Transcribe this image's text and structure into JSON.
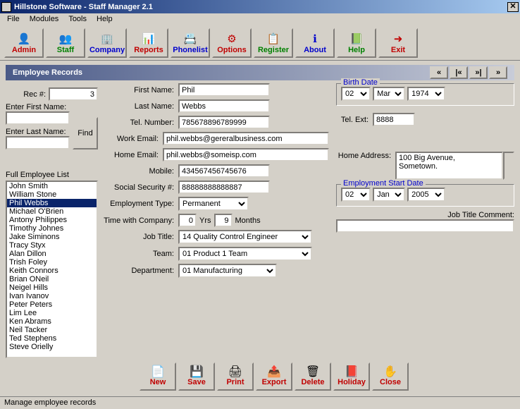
{
  "window": {
    "title": "Hillstone Software - Staff Manager 2.1"
  },
  "menu": [
    "File",
    "Modules",
    "Tools",
    "Help"
  ],
  "toolbar": [
    {
      "label": "Admin",
      "icon": "👤",
      "cls": "red"
    },
    {
      "label": "Staff",
      "icon": "👥",
      "cls": "green"
    },
    {
      "label": "Company",
      "icon": "🏢",
      "cls": "blue"
    },
    {
      "label": "Reports",
      "icon": "📊",
      "cls": "red"
    },
    {
      "label": "Phonelist",
      "icon": "📇",
      "cls": "blue"
    },
    {
      "label": "Options",
      "icon": "⚙",
      "cls": "red"
    },
    {
      "label": "Register",
      "icon": "📋",
      "cls": "green"
    },
    {
      "label": "About",
      "icon": "ℹ",
      "cls": "blue"
    },
    {
      "label": "Help",
      "icon": "📗",
      "cls": "green"
    },
    {
      "label": "Exit",
      "icon": "➜",
      "cls": "red"
    }
  ],
  "header": {
    "title": "Employee Records"
  },
  "nav": [
    "«",
    "|«",
    "»|",
    "»"
  ],
  "left": {
    "rec_label": "Rec #:",
    "rec_value": "3",
    "first_label": "Enter First Name:",
    "first_value": "",
    "last_label": "Enter Last Name:",
    "last_value": "",
    "find": "Find",
    "list_label": "Full Employee List",
    "list": [
      "John Smith",
      "William Stone",
      "Phil Webbs",
      "Michael O'Brien",
      "Antony Philippes",
      "Timothy Johnes",
      "Jake Siminons",
      "Tracy Styx",
      "Alan Dillon",
      "Trish Foley",
      "Keith Connors",
      "Brian ONeil",
      "Neigel Hills",
      "Ivan Ivanov",
      "Peter Peters",
      "Lim Lee",
      "Ken Abrams",
      "Neil Tacker",
      "Ted Stephens",
      "Steve Orielly"
    ],
    "selected_index": 2
  },
  "form": {
    "first_name": {
      "label": "First Name:",
      "value": "Phil"
    },
    "last_name": {
      "label": "Last Name:",
      "value": "Webbs"
    },
    "tel": {
      "label": "Tel. Number:",
      "value": "785678896789999"
    },
    "work_email": {
      "label": "Work Email:",
      "value": "phil.webbs@gereralbusiness.com"
    },
    "home_email": {
      "label": "Home Email:",
      "value": "phil.webbs@someisp.com"
    },
    "mobile": {
      "label": "Mobile:",
      "value": "434567456745676"
    },
    "ssn": {
      "label": "Social Security #:",
      "value": "88888888888887"
    },
    "emp_type": {
      "label": "Employment Type:",
      "value": "Permanent"
    },
    "time": {
      "label": "Time with Company:",
      "yrs": "0",
      "yrs_lbl": "Yrs",
      "mon": "9",
      "mon_lbl": "Months"
    },
    "job_title": {
      "label": "Job Title:",
      "value": "14 Quality Control Engineer"
    },
    "team": {
      "label": "Team:",
      "value": "01 Product 1 Team"
    },
    "dept": {
      "label": "Department:",
      "value": "01 Manufacturing"
    },
    "birth": {
      "legend": "Birth Date",
      "day": "02",
      "mon": "Mar",
      "year": "1974"
    },
    "tel_ext": {
      "label": "Tel. Ext:",
      "value": "8888"
    },
    "home_addr": {
      "label": "Home Address:",
      "value": "100 Big Avenue,\nSometown."
    },
    "emp_start": {
      "legend": "Employment Start Date",
      "day": "02",
      "mon": "Jan",
      "year": "2005"
    },
    "job_comment": {
      "label": "Job Title Comment:",
      "value": ""
    }
  },
  "actions": [
    {
      "label": "New",
      "icon": "📄"
    },
    {
      "label": "Save",
      "icon": "💾"
    },
    {
      "label": "Print",
      "icon": "🖨"
    },
    {
      "label": "Export",
      "icon": "📤"
    },
    {
      "label": "Delete",
      "icon": "🗑"
    },
    {
      "label": "Holiday",
      "icon": "📕"
    },
    {
      "label": "Close",
      "icon": "✋"
    }
  ],
  "status": "Manage employee records"
}
